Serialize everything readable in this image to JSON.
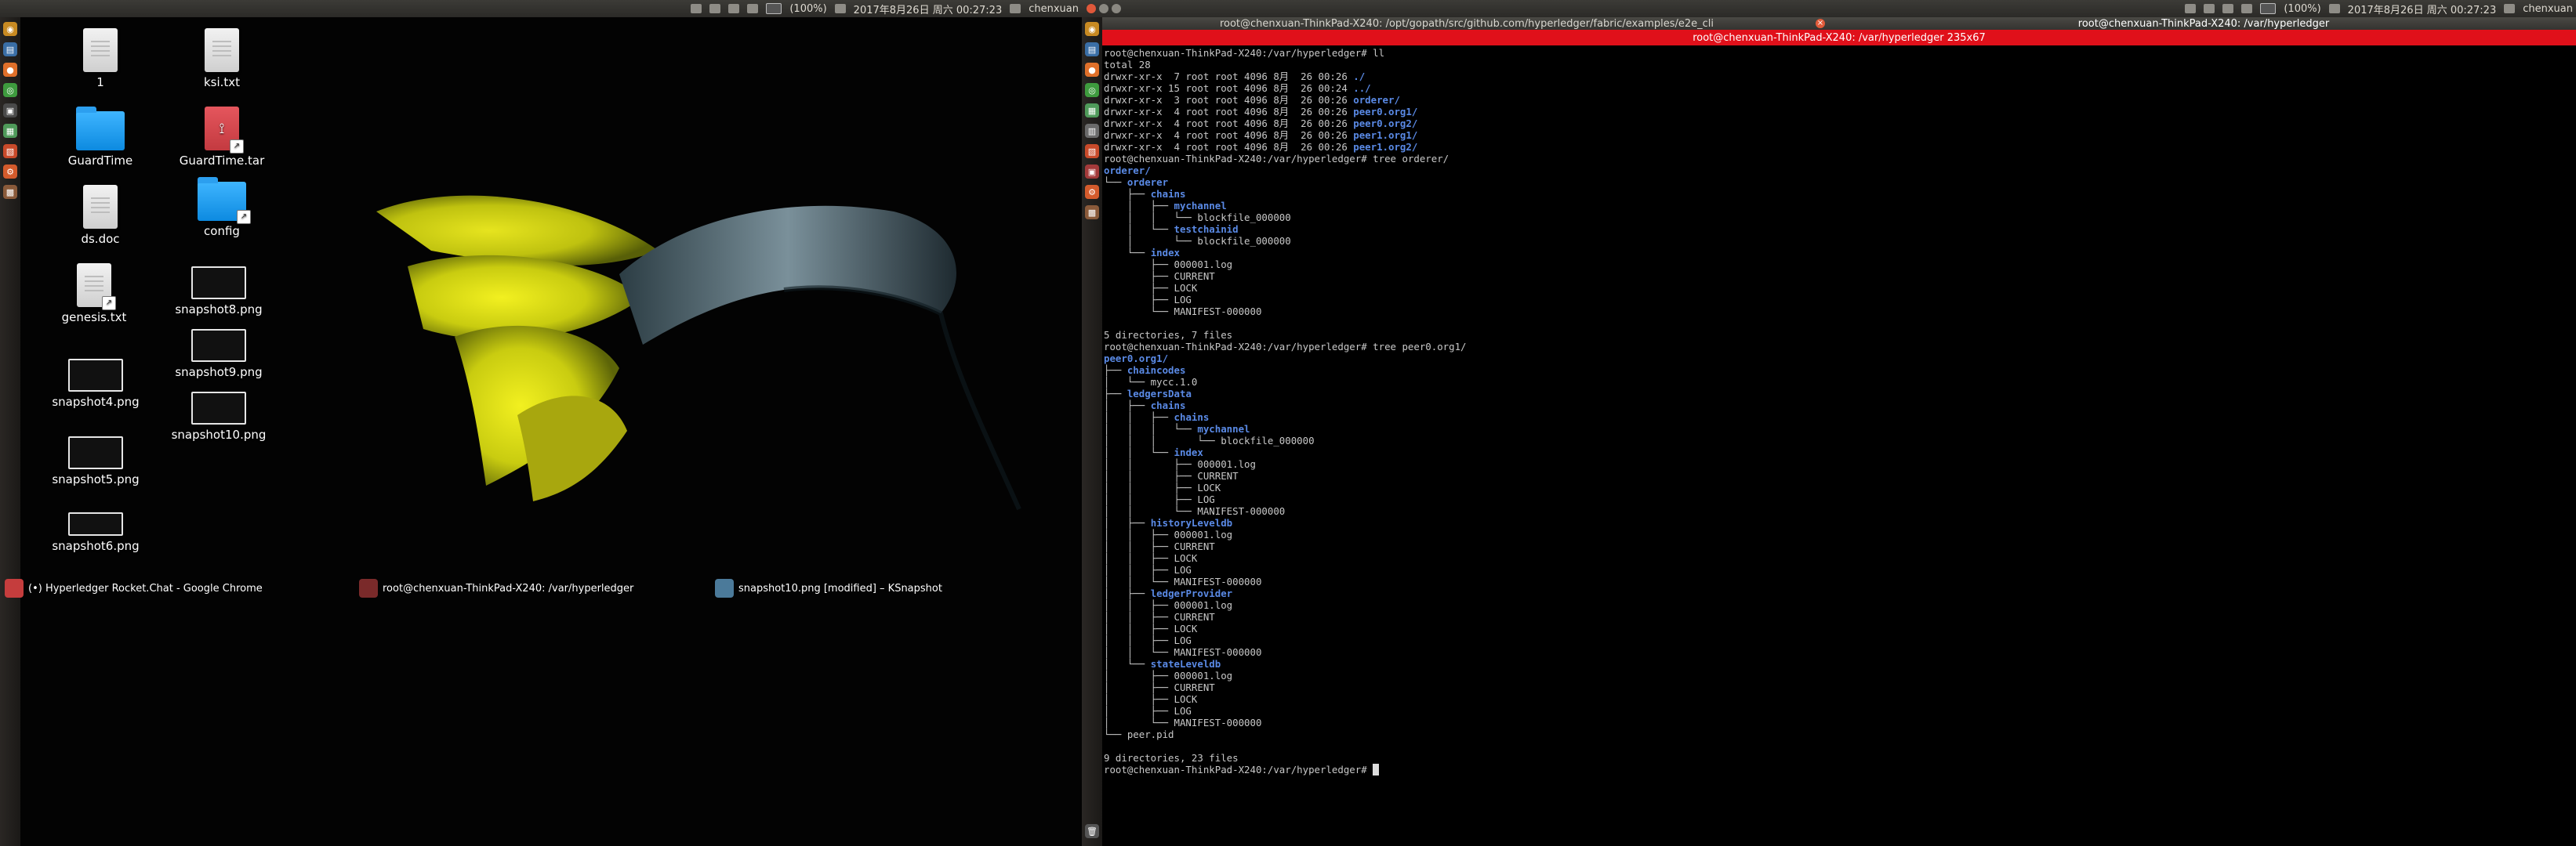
{
  "top_panel": {
    "battery": "(100%)",
    "datetime": "2017年8月26日 周六 00:27:23",
    "user": "chenxuan"
  },
  "launcher_icons": [
    "ubuntu-icon",
    "files-icon",
    "firefox-icon",
    "chrome-icon",
    "terminal-icon",
    "calc-icon",
    "impress-icon",
    "settings-icon",
    "app-icon"
  ],
  "desktop": {
    "icons": [
      {
        "label": "1",
        "type": "doc"
      },
      {
        "label": "ksi.txt",
        "type": "doc"
      },
      {
        "label": "GuardTime",
        "type": "folder"
      },
      {
        "label": "GuardTime.tar",
        "type": "tar"
      },
      {
        "label": "ds.doc",
        "type": "doc"
      },
      {
        "label": "config",
        "type": "folder"
      },
      {
        "label": "genesis.txt",
        "type": "doc"
      },
      {
        "label": "snapshot8.png",
        "type": "shot"
      },
      {
        "label": "snapshot9.png",
        "type": "shot"
      },
      {
        "label": "snapshot4.png",
        "type": "shot"
      },
      {
        "label": "snapshot10.png",
        "type": "shot"
      },
      {
        "label": "snapshot5.png",
        "type": "shot"
      },
      {
        "label": "snapshot6.png",
        "type": "shot"
      }
    ]
  },
  "tasks": [
    {
      "label": "(•) Hyperledger Rocket.Chat - Google Chrome"
    },
    {
      "label": "root@chenxuan-ThinkPad-X240: /var/hyperledger"
    },
    {
      "label": "snapshot10.png [modified] – KSnapshot"
    }
  ],
  "terminal": {
    "tab1_title": "root@chenxuan-ThinkPad-X240: /opt/gopath/src/github.com/hyperledger/fabric/examples/e2e_cli",
    "tab2_title": "root@chenxuan-ThinkPad-X240: /var/hyperledger",
    "window_title": "root@chenxuan-ThinkPad-X240: /var/hyperledger 235x67",
    "lines": [
      {
        "t": "root@chenxuan-ThinkPad-X240:/var/hyperledger# ll"
      },
      {
        "t": "total 28"
      },
      {
        "t": "drwxr-xr-x  7 root root 4096 8月  26 00:26 ",
        "d": "./"
      },
      {
        "t": "drwxr-xr-x 15 root root 4096 8月  26 00:24 ",
        "d": "../"
      },
      {
        "t": "drwxr-xr-x  3 root root 4096 8月  26 00:26 ",
        "d": "orderer/"
      },
      {
        "t": "drwxr-xr-x  4 root root 4096 8月  26 00:26 ",
        "d": "peer0.org1/"
      },
      {
        "t": "drwxr-xr-x  4 root root 4096 8月  26 00:26 ",
        "d": "peer0.org2/"
      },
      {
        "t": "drwxr-xr-x  4 root root 4096 8月  26 00:26 ",
        "d": "peer1.org1/"
      },
      {
        "t": "drwxr-xr-x  4 root root 4096 8月  26 00:26 ",
        "d": "peer1.org2/"
      },
      {
        "t": "root@chenxuan-ThinkPad-X240:/var/hyperledger# tree orderer/"
      },
      {
        "t": "",
        "d": "orderer/"
      },
      {
        "t": "└── ",
        "d": "orderer"
      },
      {
        "t": "    ├── ",
        "d": "chains"
      },
      {
        "t": "    │   ├── ",
        "d": "mychannel"
      },
      {
        "t": "    │   │   └── blockfile_000000"
      },
      {
        "t": "    │   └── ",
        "d": "testchainid"
      },
      {
        "t": "    │       └── blockfile_000000"
      },
      {
        "t": "    └── ",
        "d": "index"
      },
      {
        "t": "        ├── 000001.log"
      },
      {
        "t": "        ├── CURRENT"
      },
      {
        "t": "        ├── LOCK"
      },
      {
        "t": "        ├── LOG"
      },
      {
        "t": "        └── MANIFEST-000000"
      },
      {
        "t": ""
      },
      {
        "t": "5 directories, 7 files"
      },
      {
        "t": "root@chenxuan-ThinkPad-X240:/var/hyperledger# tree peer0.org1/"
      },
      {
        "t": "",
        "d": "peer0.org1/"
      },
      {
        "t": "├── ",
        "d": "chaincodes"
      },
      {
        "t": "│   └── mycc.1.0"
      },
      {
        "t": "├── ",
        "d": "ledgersData"
      },
      {
        "t": "│   ├── ",
        "d": "chains"
      },
      {
        "t": "│   │   ├── ",
        "d": "chains"
      },
      {
        "t": "│   │   │   └── ",
        "d": "mychannel"
      },
      {
        "t": "│   │   │       └── blockfile_000000"
      },
      {
        "t": "│   │   └── ",
        "d": "index"
      },
      {
        "t": "│   │       ├── 000001.log"
      },
      {
        "t": "│   │       ├── CURRENT"
      },
      {
        "t": "│   │       ├── LOCK"
      },
      {
        "t": "│   │       ├── LOG"
      },
      {
        "t": "│   │       └── MANIFEST-000000"
      },
      {
        "t": "│   ├── ",
        "d": "historyLeveldb"
      },
      {
        "t": "│   │   ├── 000001.log"
      },
      {
        "t": "│   │   ├── CURRENT"
      },
      {
        "t": "│   │   ├── LOCK"
      },
      {
        "t": "│   │   ├── LOG"
      },
      {
        "t": "│   │   └── MANIFEST-000000"
      },
      {
        "t": "│   ├── ",
        "d": "ledgerProvider"
      },
      {
        "t": "│   │   ├── 000001.log"
      },
      {
        "t": "│   │   ├── CURRENT"
      },
      {
        "t": "│   │   ├── LOCK"
      },
      {
        "t": "│   │   ├── LOG"
      },
      {
        "t": "│   │   └── MANIFEST-000000"
      },
      {
        "t": "│   └── ",
        "d": "stateLeveldb"
      },
      {
        "t": "│       ├── 000001.log"
      },
      {
        "t": "│       ├── CURRENT"
      },
      {
        "t": "│       ├── LOCK"
      },
      {
        "t": "│       ├── LOG"
      },
      {
        "t": "│       └── MANIFEST-000000"
      },
      {
        "t": "└── peer.pid"
      },
      {
        "t": ""
      },
      {
        "t": "9 directories, 23 files"
      },
      {
        "t": "root@chenxuan-ThinkPad-X240:/var/hyperledger# ",
        "cursor": true
      }
    ]
  }
}
